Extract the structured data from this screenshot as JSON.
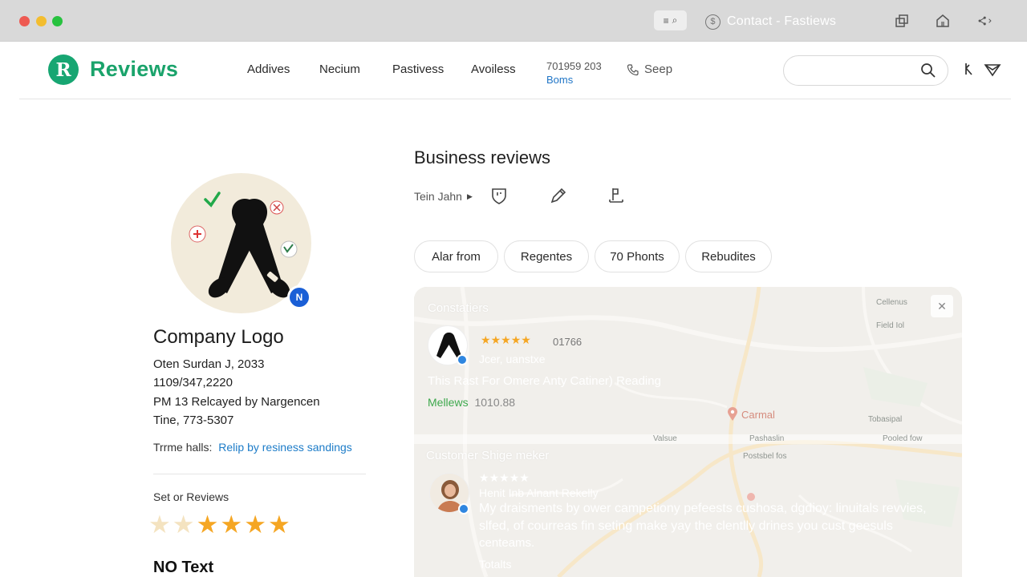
{
  "window": {
    "title": "Contact - Fastiews"
  },
  "brand": {
    "logo_letter": "R",
    "name": "Reviews",
    "color": "#1aa36b"
  },
  "nav": {
    "links": [
      "Addives",
      "Necium",
      "Pastivess",
      "Avoiless"
    ],
    "phone_number": "701959 203",
    "phone_sub": "Boms",
    "sleep_label": "Seep",
    "search_placeholder": ""
  },
  "profile": {
    "badge_letter": "N",
    "title": "Company Logo",
    "lines": [
      "Oten Surdan J, 2033",
      "1109/347,2220",
      "PM 13 Relcayed by Nargencen",
      "Tine, 773-5307"
    ],
    "trust_label": "Trrme halls:",
    "trust_link": "Relip by resiness sandings",
    "rating_label": "Set or Reviews",
    "rating_value": 4,
    "rating_max": 6,
    "footer_label": "NO Text"
  },
  "main": {
    "title": "Business reviews",
    "author": "Tein Jahn",
    "chips": [
      "Alar from",
      "Regentes",
      "70 Phonts",
      "Rebudites"
    ]
  },
  "panel": {
    "section1_label": "Constatiers",
    "review1": {
      "stars": 5,
      "count": "01766",
      "name": "Jcer, uanstxe",
      "text": "This Rast For Omere Anty Catiner) Reading",
      "meta_label": "Mellews",
      "meta_value": "1010.88"
    },
    "section2_label": "Customer Shige meker",
    "review2": {
      "stars": 5,
      "name": "Henit Inb Alnant Rekelly",
      "text_lines": [
        "My draisments by ower campetiony pefeests cushosa, dgdioy: linuitals revvies,",
        "slfed, of courreas fin seting make yay the clentlly drines you cust geesuls",
        "centeams."
      ],
      "footer": "Totalts"
    },
    "map_labels": {
      "carmel": "Carmal",
      "top_right": "Cellenus",
      "top_right2": "Field Iol",
      "mid_right": "Tobasipal",
      "band_left": "Valsue",
      "band_mid": "Pashaslin",
      "band_right": "Pooled fow",
      "road": "Postsbel fos"
    }
  },
  "colors": {
    "star": "#f5a623",
    "star_faded": "#f4e3c0",
    "link": "#1d7cc8",
    "badge": "#1a5fd6"
  }
}
